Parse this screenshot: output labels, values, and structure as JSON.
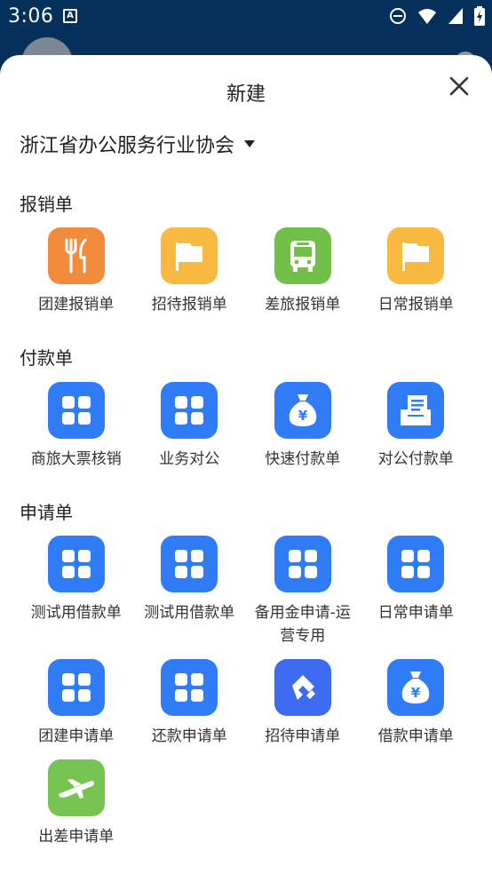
{
  "status": {
    "time": "3:06",
    "notif_glyph": "A"
  },
  "sheet": {
    "title": "新建",
    "org": "浙江省办公服务行业协会"
  },
  "sections": [
    {
      "title": "报销单",
      "items": [
        {
          "label": "团建报销单",
          "icon": "utensils-icon",
          "color": "#f08c3b"
        },
        {
          "label": "招待报销单",
          "icon": "flag-icon",
          "color": "#f7b93f"
        },
        {
          "label": "差旅报销单",
          "icon": "bus-icon",
          "color": "#72c04a"
        },
        {
          "label": "日常报销单",
          "icon": "flag-icon",
          "color": "#f7b93f"
        }
      ]
    },
    {
      "title": "付款单",
      "items": [
        {
          "label": "商旅大票核销",
          "icon": "grid-icon",
          "color": "#2f7cf6"
        },
        {
          "label": "业务对公",
          "icon": "grid-icon",
          "color": "#2f7cf6"
        },
        {
          "label": "快速付款单",
          "icon": "money-bag-icon",
          "color": "#2f7cf6"
        },
        {
          "label": "对公付款单",
          "icon": "inbox-icon",
          "color": "#2f7cf6"
        }
      ]
    },
    {
      "title": "申请单",
      "items": [
        {
          "label": "测试用借款单",
          "icon": "grid-icon",
          "color": "#2f7cf6"
        },
        {
          "label": "测试用借款单",
          "icon": "grid-icon",
          "color": "#2f7cf6"
        },
        {
          "label": "备用金申请-运营专用",
          "icon": "grid-icon",
          "color": "#2f7cf6"
        },
        {
          "label": "日常申请单",
          "icon": "grid-icon",
          "color": "#2f7cf6"
        },
        {
          "label": "团建申请单",
          "icon": "grid-icon",
          "color": "#2f7cf6"
        },
        {
          "label": "还款申请单",
          "icon": "grid-icon",
          "color": "#2f7cf6"
        },
        {
          "label": "招待申请单",
          "icon": "handshake-icon",
          "color": "#3d6cf0"
        },
        {
          "label": "借款申请单",
          "icon": "money-bag-icon",
          "color": "#2f7cf6"
        },
        {
          "label": "出差申请单",
          "icon": "airplane-icon",
          "color": "#78c452"
        }
      ]
    }
  ]
}
